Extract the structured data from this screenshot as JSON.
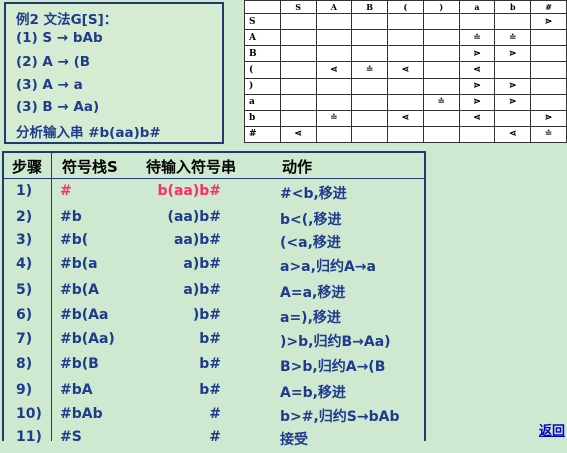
{
  "grammar": {
    "title": "例2 文法G[S]：",
    "rules": [
      "(1) S → bAb",
      "(2) A → (B",
      "(3) A → a",
      "(3) B → Aa)"
    ],
    "task": "分析输入串 #b(aa)b#"
  },
  "precedence": {
    "columns": [
      "",
      "S",
      "A",
      "B",
      "(",
      ")",
      "a",
      "b",
      "#"
    ],
    "rows": [
      {
        "sym": "S",
        "cells": [
          "",
          "",
          "",
          "",
          "",
          "",
          "",
          "⋗"
        ]
      },
      {
        "sym": "A",
        "cells": [
          "",
          "",
          "",
          "",
          "",
          "≐",
          "≐",
          ""
        ]
      },
      {
        "sym": "B",
        "cells": [
          "",
          "",
          "",
          "",
          "",
          "⋗",
          "⋗",
          ""
        ]
      },
      {
        "sym": "(",
        "cells": [
          "",
          "⋖",
          "≐",
          "⋖",
          "",
          "⋖",
          "",
          ""
        ]
      },
      {
        "sym": ")",
        "cells": [
          "",
          "",
          "",
          "",
          "",
          "⋗",
          "⋗",
          ""
        ]
      },
      {
        "sym": "a",
        "cells": [
          "",
          "",
          "",
          "",
          "≐",
          "⋗",
          "⋗",
          ""
        ]
      },
      {
        "sym": "b",
        "cells": [
          "",
          "≐",
          "",
          "⋖",
          "",
          "⋖",
          "",
          "⋗"
        ]
      },
      {
        "sym": "#",
        "cells": [
          "⋖",
          "",
          "",
          "",
          "",
          "",
          "⋖",
          "≐"
        ]
      }
    ]
  },
  "analysis": {
    "headers": {
      "step": "步骤",
      "stack": "符号栈S",
      "input": "待输入符号串",
      "action": "动作"
    },
    "rows": [
      {
        "step": "1)",
        "stack": "#",
        "input": "b(aa)b#",
        "action": "#<b,移进"
      },
      {
        "step": "2)",
        "stack": "#b",
        "input": "(aa)b#",
        "action": "b<(,移进"
      },
      {
        "step": "3)",
        "stack": "#b(",
        "input": "aa)b#",
        "action": "(<a,移进"
      },
      {
        "step": "4)",
        "stack": "#b(a",
        "input": "a)b#",
        "action": "a>a,归约A→a"
      },
      {
        "step": "5)",
        "stack": "#b(A",
        "input": "a)b#",
        "action": "A=a,移进"
      },
      {
        "step": "6)",
        "stack": "#b(Aa",
        "input": ")b#",
        "action": "a=),移进"
      },
      {
        "step": "7)",
        "stack": "#b(Aa)",
        "input": "b#",
        "action": ")>b,归约B→Aa)"
      },
      {
        "step": "8)",
        "stack": "#b(B",
        "input": "b#",
        "action": "B>b,归约A→(B"
      },
      {
        "step": "9)",
        "stack": "#bA",
        "input": "b#",
        "action": "A=b,移进"
      },
      {
        "step": "10)",
        "stack": "#bAb",
        "input": "#",
        "action": "b>#,归约S→bAb"
      },
      {
        "step": "11)",
        "stack": "#S",
        "input": "#",
        "action": "接受"
      }
    ]
  },
  "back_link": "返回"
}
